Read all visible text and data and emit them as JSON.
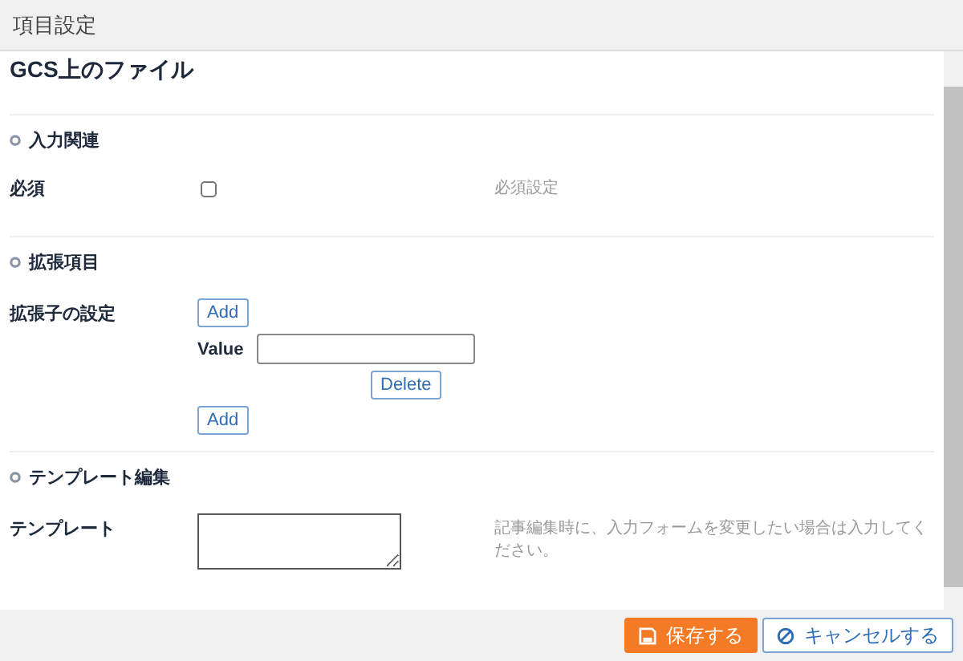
{
  "window": {
    "title": "項目設定"
  },
  "field_name": "GCS上のファイル",
  "sections": [
    {
      "heading": "入力関連",
      "rows": [
        {
          "kind": "checkbox",
          "label": "必須",
          "checked": false,
          "help": "必須設定"
        }
      ]
    },
    {
      "heading": "拡張項目",
      "rows": [
        {
          "kind": "list",
          "label": "拡張子の設定",
          "add_top": "Add",
          "value_label": "Value",
          "delete": "Delete",
          "add_bottom": "Add"
        }
      ]
    },
    {
      "heading": "テンプレート編集",
      "rows": [
        {
          "kind": "textarea",
          "label": "テンプレート",
          "help": "記事編集時に、入力フォームを変更したい場合は入力してください。"
        }
      ]
    }
  ],
  "buttons": [
    {
      "kind": "save",
      "label": "保存する"
    },
    {
      "kind": "cancel",
      "label": "キャンセルする"
    }
  ]
}
